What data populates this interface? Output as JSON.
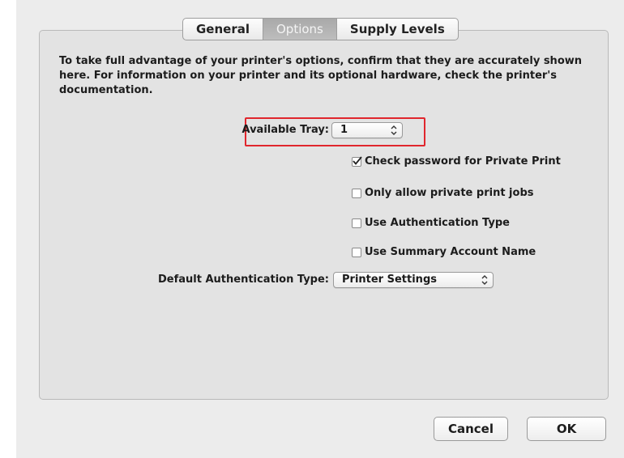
{
  "tabs": [
    {
      "label": "General",
      "selected": false
    },
    {
      "label": "Options",
      "selected": true
    },
    {
      "label": "Supply Levels",
      "selected": false
    }
  ],
  "description": "To take full advantage of your printer's options, confirm that they are accurately shown here. For information on your printer and its optional hardware, check the printer's documentation.",
  "available_tray": {
    "label": "Available Tray:",
    "value": "1",
    "highlight_color": "#e0262d"
  },
  "checkboxes": [
    {
      "label": "Check password for Private Print",
      "checked": true
    },
    {
      "label": "Only allow private print jobs",
      "checked": false
    },
    {
      "label": "Use Authentication Type",
      "checked": false
    },
    {
      "label": "Use Summary Account Name",
      "checked": false
    }
  ],
  "default_auth": {
    "label": "Default Authentication Type:",
    "value": "Printer Settings"
  },
  "buttons": {
    "cancel": "Cancel",
    "ok": "OK"
  },
  "icons": {
    "popup_arrows": "up-down-chevrons-icon",
    "check": "checkmark-icon"
  }
}
